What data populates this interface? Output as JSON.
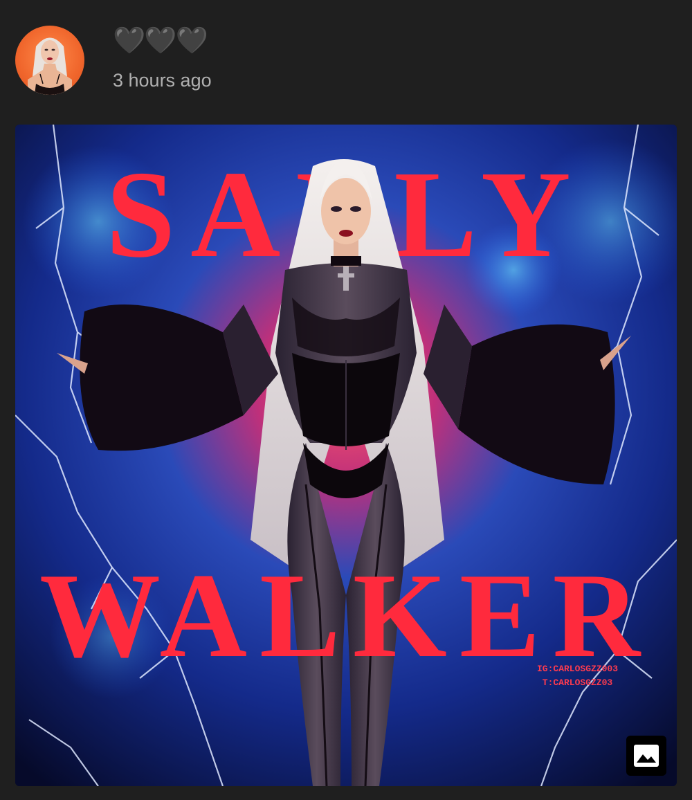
{
  "post": {
    "reactions": "🖤🖤🖤",
    "timestamp": "3 hours ago"
  },
  "media": {
    "artwork_title_top": "SALLY",
    "artwork_title_bottom": "WALKER",
    "credit_line_1": "IG:CARLOSGZZ003",
    "credit_line_2": "T:CARLOSGZZ03",
    "gallery_icon": "image-icon"
  },
  "colors": {
    "background": "#1f1f1f",
    "title_red": "#ff2a3d",
    "timestamp_gray": "#b0b0b0"
  }
}
